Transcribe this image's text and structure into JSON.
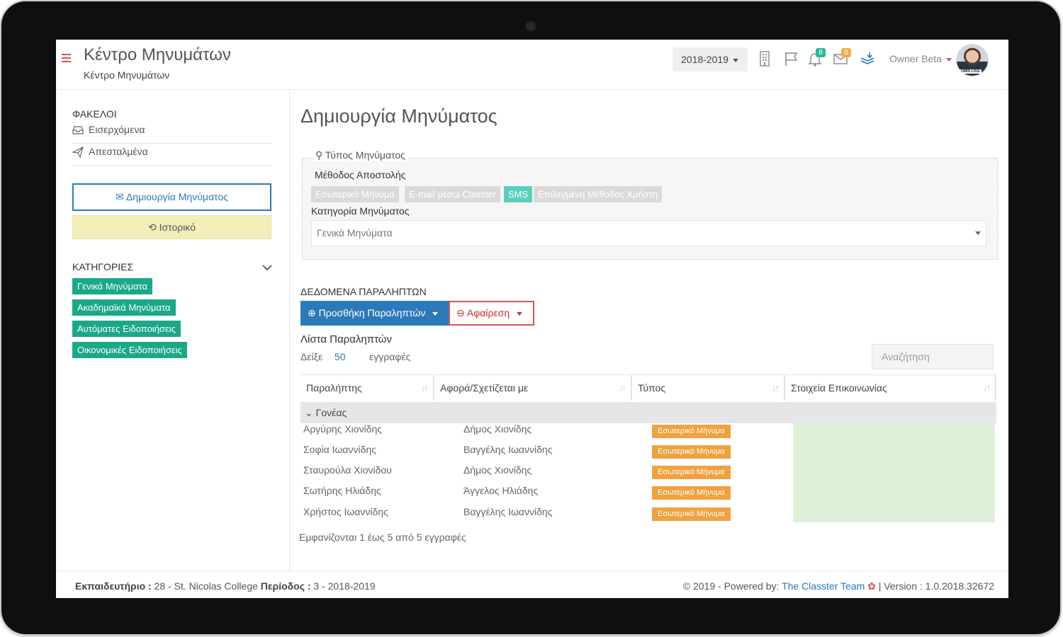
{
  "header": {
    "title": "Κέντρο Μηνυμάτων",
    "subtitle": "Κέντρο Μηνυμάτων",
    "year": "2018-2019",
    "notifications_count": "8",
    "messages_count": "0",
    "user_name": "Owner Beta",
    "avatar_text": "OMIN LOGI"
  },
  "sidebar": {
    "folders_title": "ΦΑΚΕΛΟΙ",
    "folders": [
      {
        "label": "Εισερχόμενα",
        "icon": "inbox-icon"
      },
      {
        "label": "Απεσταλμένα",
        "icon": "paper-plane-icon"
      }
    ],
    "create_button": "Δημιουργία Μηνύματος",
    "history_button": "Ιστορικό",
    "categories_title": "ΚΑΤΗΓΟΡΙΕΣ",
    "categories": [
      "Γενικά Μηνύματα",
      "Ακαδημαϊκά Μηνύματα",
      "Αυτόματες Ειδοποιήσεις",
      "Οικονομικές Ειδοποιήσεις"
    ]
  },
  "main": {
    "page_title": "Δημιουργία Μηνύματος",
    "message_type_legend": "Τύπος Μηνύματος",
    "method_label": "Μέθοδος Αποστολής",
    "methods": [
      "Εσωτερικό Μήνυμα",
      "E-mail μέσω Classter",
      "SMS",
      "Επιλεγμένη Μέθοδος Χρήστη"
    ],
    "active_method": "SMS",
    "category_label": "Κατηγορία Μηνύματος",
    "category_value": "Γενικά Μηνύματα",
    "recipients_title": "ΔΕΔΟΜΕΝΑ ΠΑΡΑΛΗΠΤΩΝ",
    "add_recipients": "Προσθήκη Παραληπτών",
    "remove": "Αφαίρεση",
    "list_title": "Λίστα Παραληπτών",
    "show_label": "Δείξε",
    "show_value": "50",
    "show_suffix": "εγγραφές",
    "search_placeholder": "Αναζήτηση",
    "columns": [
      "Παραλήπτης",
      "Αφορά/Σχετίζεται με",
      "Τύπος",
      "Στοιχεία Επικοινωνίας"
    ],
    "group_label": "Γονέας",
    "rows": [
      {
        "recipient": "Αργύρης Χιονίδης",
        "related": "Δήμος Χιονίδης",
        "type": "Εσωτερικό Μήνυμα"
      },
      {
        "recipient": "Σοφία Ιωαννίδης",
        "related": "Βαγγέλης Ιωαννίδης",
        "type": "Εσωτερικό Μήνυμα"
      },
      {
        "recipient": "Σταυρούλα Χιονίδου",
        "related": "Δήμος Χιονίδης",
        "type": "Εσωτερικό Μήνυμα"
      },
      {
        "recipient": "Σωτήρης Ηλιάδης",
        "related": "Άγγελος Ηλιάδης",
        "type": "Εσωτερικό Μήνυμα"
      },
      {
        "recipient": "Χρήστος Ιωαννίδης",
        "related": "Βαγγέλης Ιωαννίδης",
        "type": "Εσωτερικό Μήνυμα"
      }
    ],
    "info": "Εμφανίζονται 1 έως 5 από 5 εγγραφές"
  },
  "footer": {
    "institution_label": "Εκπαιδευτήριο :",
    "institution_value": "28 - St. Nicolas College",
    "period_label": "Περίοδος :",
    "period_value": "3 - 2018-2019",
    "copyright_prefix": "2019 - Powered by:",
    "team_link": "The Classter Team",
    "version": "| Version : 1.0.2018.32672"
  },
  "colors": {
    "primary": "#2b79b9",
    "danger": "#d9534f",
    "teal": "#1aa888",
    "orange": "#f0a140",
    "history_bg": "#f3eeb9"
  }
}
